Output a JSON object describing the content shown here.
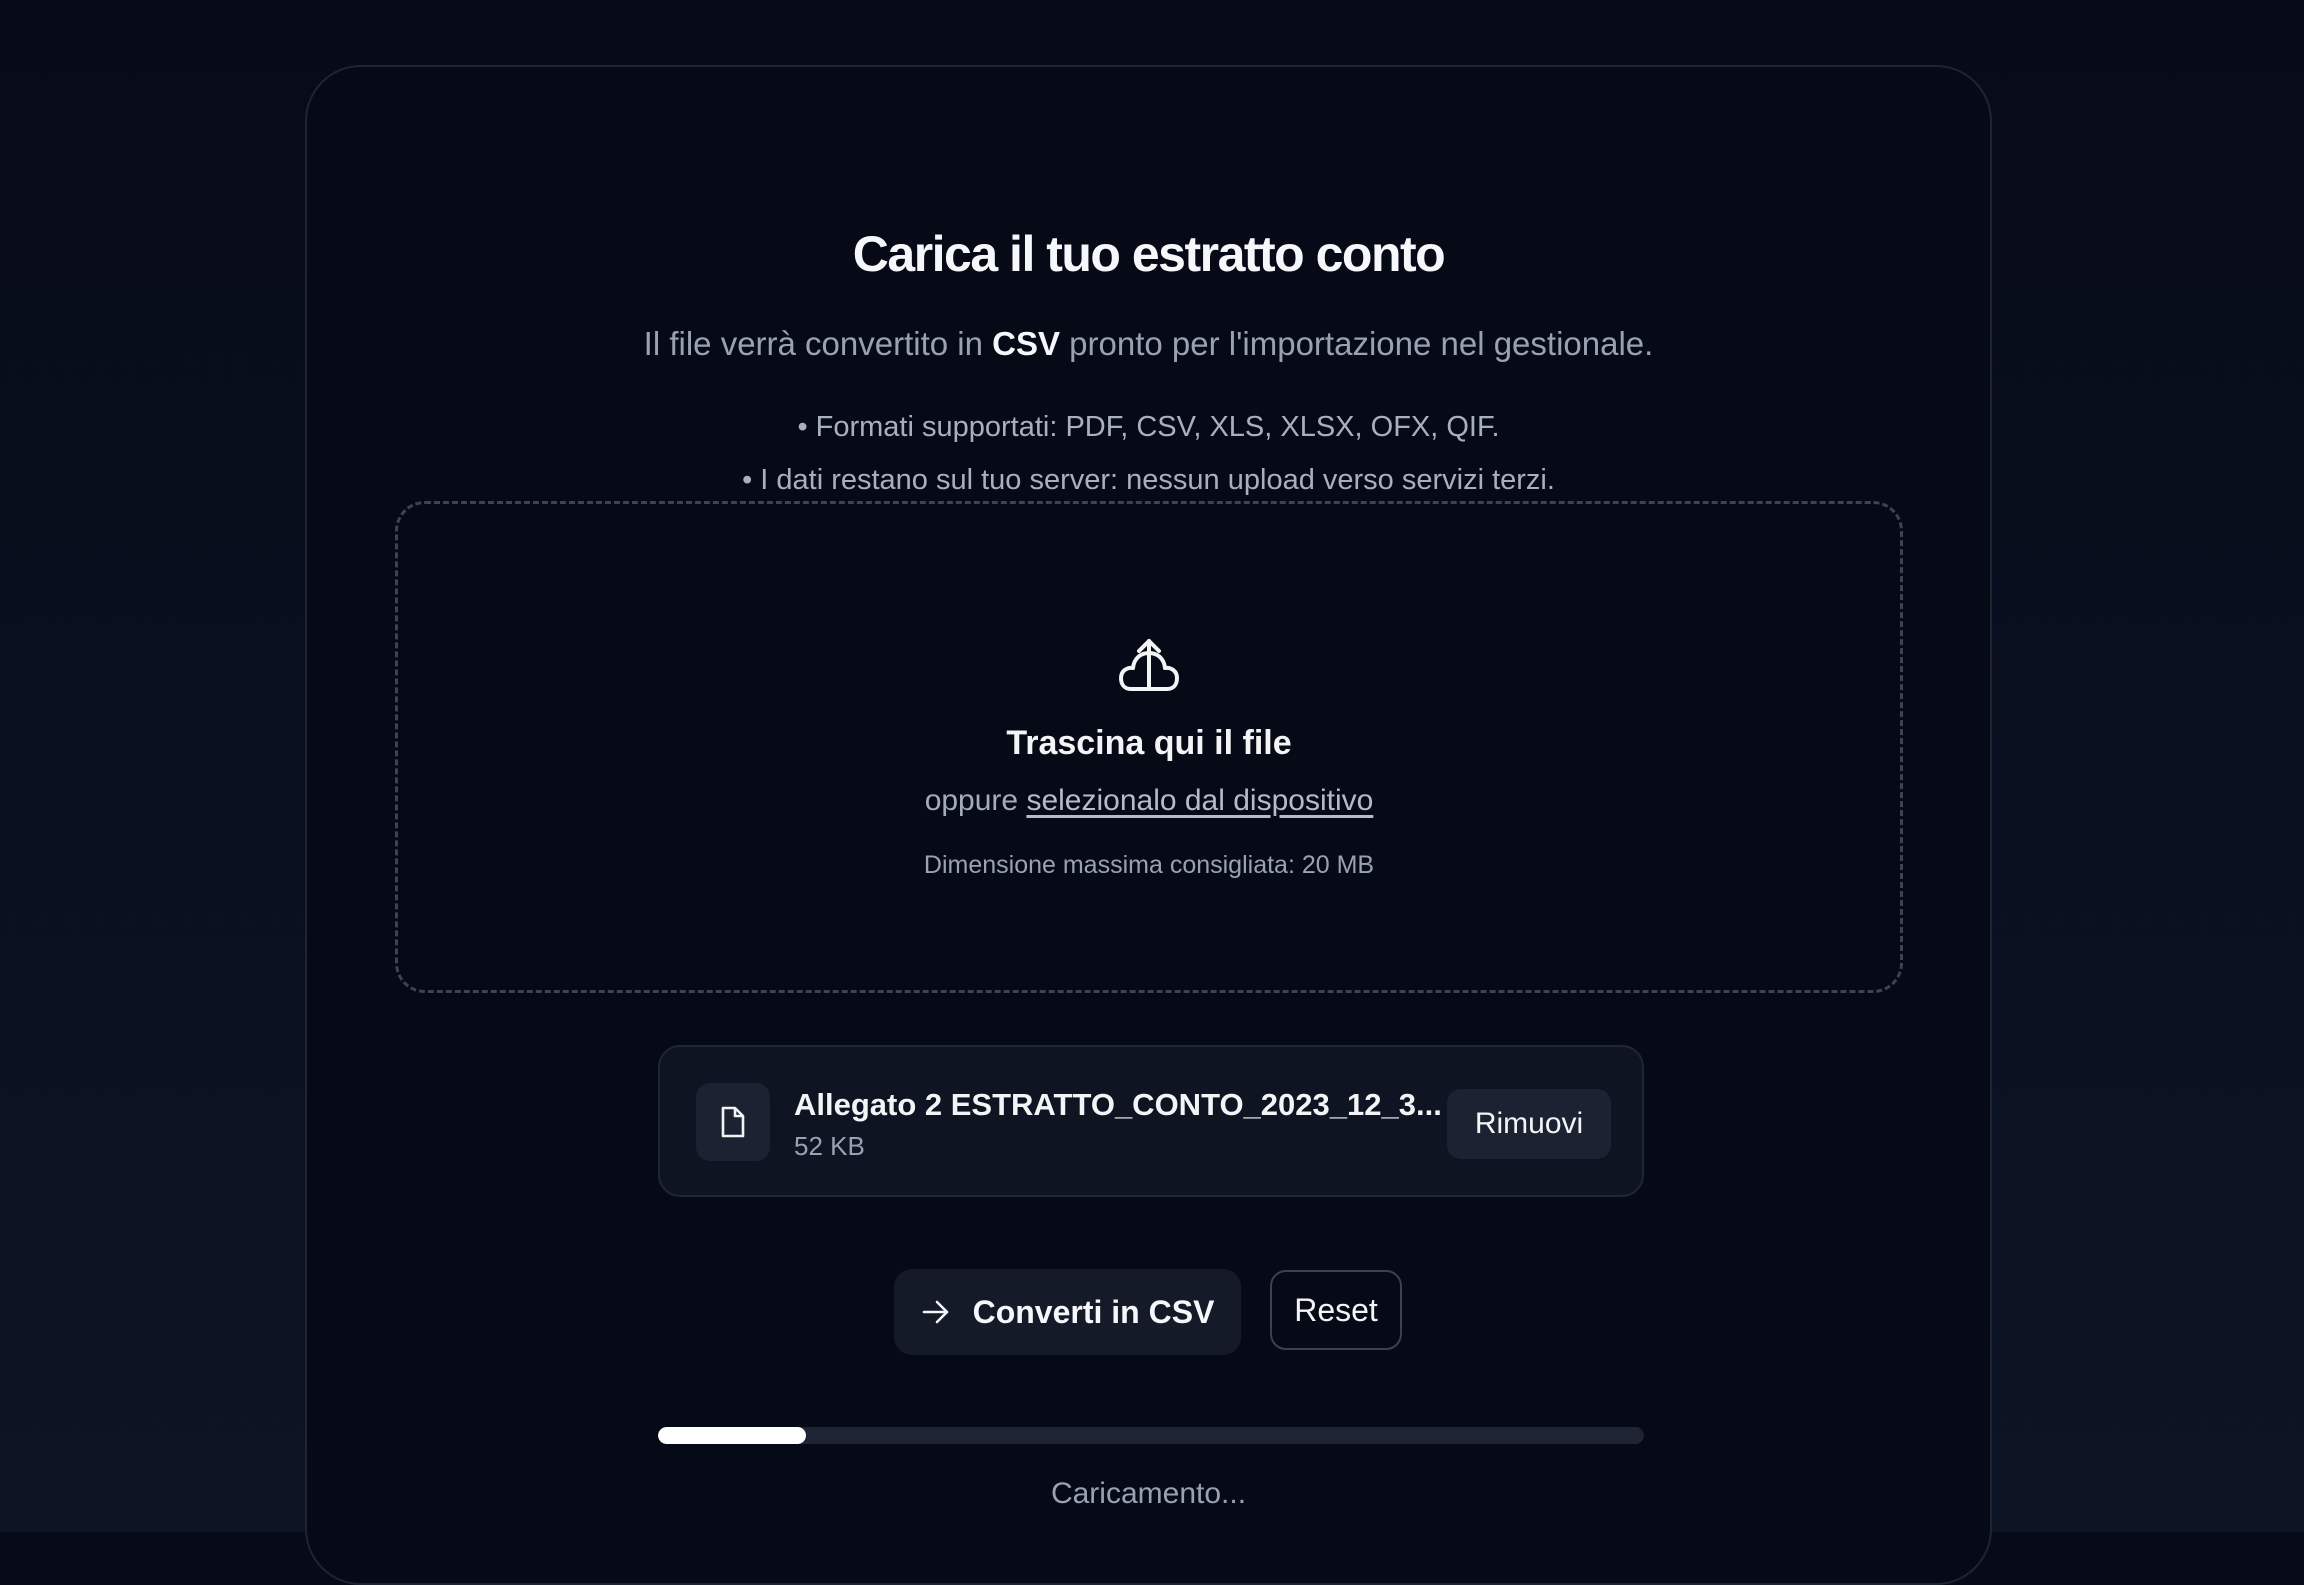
{
  "header": {
    "title": "Carica il tuo estratto conto",
    "subtitle_prefix": "Il file verrà convertito in ",
    "subtitle_highlight": "CSV",
    "subtitle_suffix": " pronto per l'importazione nel gestionale.",
    "bullets": [
      "• Formati supportati: PDF, CSV, XLS, XLSX, OFX, QIF.",
      "• I dati restano sul tuo server: nessun upload verso servizi terzi."
    ]
  },
  "dropzone": {
    "icon": "upload-cloud-icon",
    "title": "Trascina qui il file",
    "alt_prefix": "oppure ",
    "alt_link": "selezionalo dal dispositivo",
    "hint": "Dimensione massima consigliata: 20 MB"
  },
  "file": {
    "icon": "file-icon",
    "name": "Allegato 2 ESTRATTO_CONTO_2023_12_3...",
    "size": "52 KB",
    "remove_label": "Rimuovi"
  },
  "actions": {
    "convert_icon": "arrow-right-icon",
    "convert_label": "Converti in CSV",
    "reset_label": "Reset"
  },
  "progress": {
    "fraction": 0.15,
    "status": "Caricamento..."
  }
}
